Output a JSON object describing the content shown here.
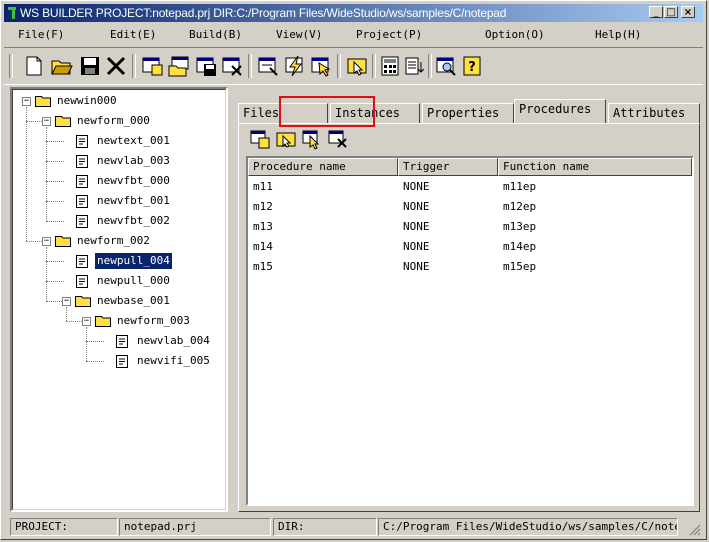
{
  "window": {
    "title": "WS BUILDER PROJECT:notepad.prj DIR:C:/Program Files/WideStudio/ws/samples/C/notepad",
    "buttons": [
      "_",
      "□",
      "×"
    ]
  },
  "menu": [
    "File(F)",
    "Edit(E)",
    "Build(B)",
    "View(V)",
    "Project(P)",
    "Option(O)",
    "Help(H)"
  ],
  "toolbar_icons": [
    "new-file-icon",
    "open-folder-icon",
    "save-icon",
    "close-x-icon",
    "new-form-icon",
    "open-form-icon",
    "save-form-icon",
    "delete-form-icon",
    "build-icon",
    "lightning-icon",
    "run-icon",
    "select-icon",
    "calculator-icon",
    "list-icon",
    "search-icon",
    "help-icon"
  ],
  "tree": {
    "nodes": [
      {
        "label": "newwin000",
        "type": "folder",
        "level": 0,
        "expander": "−"
      },
      {
        "label": "newform_000",
        "type": "folder",
        "level": 1,
        "expander": "−"
      },
      {
        "label": "newtext_001",
        "type": "doc",
        "level": 2
      },
      {
        "label": "newvlab_003",
        "type": "doc",
        "level": 2
      },
      {
        "label": "newvfbt_000",
        "type": "doc",
        "level": 2
      },
      {
        "label": "newvfbt_001",
        "type": "doc",
        "level": 2
      },
      {
        "label": "newvfbt_002",
        "type": "doc",
        "level": 2
      },
      {
        "label": "newform_002",
        "type": "folder",
        "level": 1,
        "expander": "−"
      },
      {
        "label": "newpull_004",
        "type": "doc",
        "level": 2,
        "selected": true
      },
      {
        "label": "newpull_000",
        "type": "doc",
        "level": 2
      },
      {
        "label": "newbase_001",
        "type": "folder",
        "level": 2,
        "expander": "−"
      },
      {
        "label": "newform_003",
        "type": "folder",
        "level": 3,
        "expander": "−"
      },
      {
        "label": "newvlab_004",
        "type": "doc",
        "level": 4
      },
      {
        "label": "newvifi_005",
        "type": "doc",
        "level": 4
      }
    ]
  },
  "tabs": [
    "Files",
    "Instances",
    "Properties",
    "Procedures",
    "Attributes"
  ],
  "active_tab": "Procedures",
  "highlight_color": "#e01010",
  "procedure_tools": [
    "new-procedure-icon",
    "open-procedure-icon",
    "edit-procedure-icon",
    "delete-procedure-icon"
  ],
  "table": {
    "headers": [
      "Procedure name",
      "Trigger",
      "Function name"
    ],
    "rows": [
      [
        "m11",
        "NONE",
        "m11ep"
      ],
      [
        "m12",
        "NONE",
        "m12ep"
      ],
      [
        "m13",
        "NONE",
        "m13ep"
      ],
      [
        "m14",
        "NONE",
        "m14ep"
      ],
      [
        "m15",
        "NONE",
        "m15ep"
      ]
    ]
  },
  "status": {
    "project_label": "PROJECT:",
    "project_value": "notepad.prj",
    "dir_label": "DIR:",
    "dir_value": "C:/Program Files/WideStudio/ws/samples/C/note"
  }
}
